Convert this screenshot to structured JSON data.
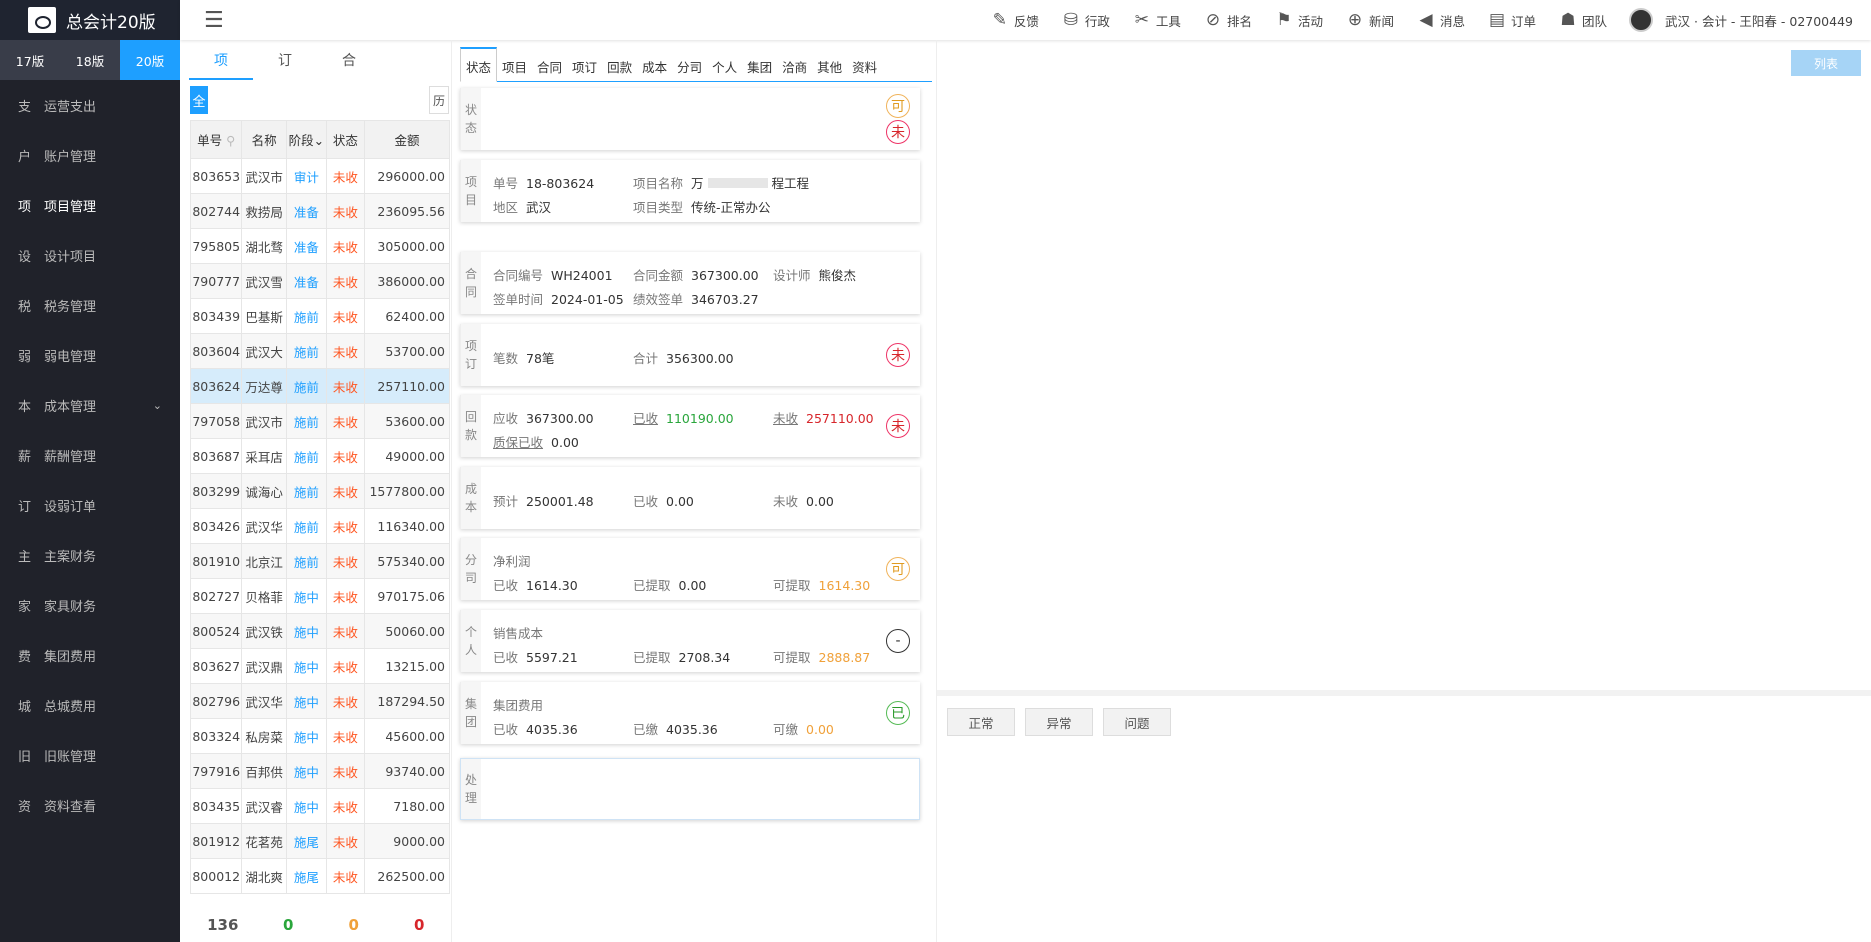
{
  "app": {
    "title": "总会计20版"
  },
  "topnav": [
    {
      "icon": "edit-icon",
      "glyph": "✎",
      "label": "反馈"
    },
    {
      "icon": "layers-icon",
      "glyph": "⛁",
      "label": "行政"
    },
    {
      "icon": "tools-icon",
      "glyph": "✂",
      "label": "工具"
    },
    {
      "icon": "compass-icon",
      "glyph": "⊘",
      "label": "排名"
    },
    {
      "icon": "flag-icon",
      "glyph": "⚑",
      "label": "活动"
    },
    {
      "icon": "globe-icon",
      "glyph": "⊕",
      "label": "新闻"
    },
    {
      "icon": "megaphone-icon",
      "glyph": "◀",
      "label": "消息"
    },
    {
      "icon": "clipboard-icon",
      "glyph": "▤",
      "label": "订单"
    },
    {
      "icon": "team-icon",
      "glyph": "☗",
      "label": "团队"
    }
  ],
  "user": {
    "text": "武汉 · 会计 - 王阳春 - 02700449"
  },
  "versions": [
    {
      "label": "17版"
    },
    {
      "label": "18版"
    },
    {
      "label": "20版"
    }
  ],
  "menu": [
    {
      "ch": "支",
      "label": "运营支出"
    },
    {
      "ch": "户",
      "label": "账户管理"
    },
    {
      "ch": "项",
      "label": "项目管理"
    },
    {
      "ch": "设",
      "label": "设计项目"
    },
    {
      "ch": "税",
      "label": "税务管理"
    },
    {
      "ch": "弱",
      "label": "弱电管理"
    },
    {
      "ch": "本",
      "label": "成本管理"
    },
    {
      "ch": "薪",
      "label": "薪酬管理"
    },
    {
      "ch": "订",
      "label": "设弱订单"
    },
    {
      "ch": "主",
      "label": "主案财务"
    },
    {
      "ch": "家",
      "label": "家具财务"
    },
    {
      "ch": "费",
      "label": "集团费用"
    },
    {
      "ch": "城",
      "label": "总城费用"
    },
    {
      "ch": "旧",
      "label": "旧账管理"
    },
    {
      "ch": "资",
      "label": "资料查看"
    }
  ],
  "lefttabs": [
    {
      "label": "项"
    },
    {
      "label": "订"
    },
    {
      "label": "合"
    }
  ],
  "filter": {
    "all": "全",
    "history": "历"
  },
  "table": {
    "headers": {
      "id": "单号",
      "name": "名称",
      "phase": "阶段",
      "status": "状态",
      "amount": "金额"
    },
    "rows": [
      {
        "id": "803653",
        "name": "武汉市",
        "phase": "审计",
        "status": "未收",
        "amount": "296000.00"
      },
      {
        "id": "802744",
        "name": "救捞局",
        "phase": "准备",
        "status": "未收",
        "amount": "236095.56"
      },
      {
        "id": "795805",
        "name": "湖北骛",
        "phase": "准备",
        "status": "未收",
        "amount": "305000.00"
      },
      {
        "id": "790777",
        "name": "武汉雪",
        "phase": "准备",
        "status": "未收",
        "amount": "386000.00"
      },
      {
        "id": "803439",
        "name": "巴基斯",
        "phase": "施前",
        "status": "未收",
        "amount": "62400.00"
      },
      {
        "id": "803604",
        "name": "武汉大",
        "phase": "施前",
        "status": "未收",
        "amount": "53700.00"
      },
      {
        "id": "803624",
        "name": "万达尊",
        "phase": "施前",
        "status": "未收",
        "amount": "257110.00"
      },
      {
        "id": "797058",
        "name": "武汉市",
        "phase": "施前",
        "status": "未收",
        "amount": "53600.00"
      },
      {
        "id": "803687",
        "name": "采耳店",
        "phase": "施前",
        "status": "未收",
        "amount": "49000.00"
      },
      {
        "id": "803299",
        "name": "诚海心",
        "phase": "施前",
        "status": "未收",
        "amount": "1577800.00"
      },
      {
        "id": "803426",
        "name": "武汉华",
        "phase": "施前",
        "status": "未收",
        "amount": "116340.00"
      },
      {
        "id": "801910",
        "name": "北京江",
        "phase": "施前",
        "status": "未收",
        "amount": "575340.00"
      },
      {
        "id": "802727",
        "name": "贝格菲",
        "phase": "施中",
        "status": "未收",
        "amount": "970175.06"
      },
      {
        "id": "800524",
        "name": "武汉铁",
        "phase": "施中",
        "status": "未收",
        "amount": "50060.00"
      },
      {
        "id": "803627",
        "name": "武汉鼎",
        "phase": "施中",
        "status": "未收",
        "amount": "13215.00"
      },
      {
        "id": "802796",
        "name": "武汉华",
        "phase": "施中",
        "status": "未收",
        "amount": "187294.50"
      },
      {
        "id": "803324",
        "name": "私房菜",
        "phase": "施中",
        "status": "未收",
        "amount": "45600.00"
      },
      {
        "id": "797916",
        "name": "百邦供",
        "phase": "施中",
        "status": "未收",
        "amount": "93740.00"
      },
      {
        "id": "803435",
        "name": "武汉睿",
        "phase": "施中",
        "status": "未收",
        "amount": "7180.00"
      },
      {
        "id": "801912",
        "name": "花茗苑",
        "phase": "施尾",
        "status": "未收",
        "amount": "9000.00"
      },
      {
        "id": "800012",
        "name": "湖北爽",
        "phase": "施尾",
        "status": "未收",
        "amount": "262500.00"
      }
    ],
    "footer": {
      "total": "136",
      "green": "0",
      "orange": "0",
      "red": "0"
    }
  },
  "ctabs": [
    "状态",
    "项目",
    "合同",
    "项订",
    "回款",
    "成本",
    "分司",
    "个人",
    "集团",
    "洽商",
    "其他",
    "资料"
  ],
  "cards": {
    "status": {
      "side": "状态",
      "b1": "可",
      "b2": "未"
    },
    "project": {
      "side": "项目",
      "k_id": "单号",
      "v_id": "18-803624",
      "k_name": "项目名称",
      "v_name": "万",
      "v_name2": "程工程",
      "k_area": "地区",
      "v_area": "武汉",
      "k_type": "项目类型",
      "v_type": "传统-正常办公"
    },
    "contract": {
      "side": "合同",
      "k_no": "合同编号",
      "v_no": "WH24001",
      "k_amt": "合同金额",
      "v_amt": "367300.00",
      "k_des": "设计师",
      "v_des": "熊俊杰",
      "k_date": "签单时间",
      "v_date": "2024-01-05",
      "k_perf": "绩效签单",
      "v_perf": "346703.27"
    },
    "order": {
      "side": "项订",
      "k_cnt": "笔数",
      "v_cnt": "78笔",
      "k_sum": "合计",
      "v_sum": "356300.00",
      "badge": "未"
    },
    "payment": {
      "side": "回款",
      "k_due": "应收",
      "v_due": "367300.00",
      "k_got": "已收",
      "v_got": "110190.00",
      "k_un": "未收",
      "v_un": "257110.00",
      "k_dep": "质保已收",
      "v_dep": "0.00",
      "badge": "未"
    },
    "cost": {
      "side": "成本",
      "k_est": "预计",
      "v_est": "250001.48",
      "k_got": "已收",
      "v_got": "0.00",
      "k_un": "未收",
      "v_un": "0.00"
    },
    "branch": {
      "side": "分司",
      "title": "净利润",
      "k_got": "已收",
      "v_got": "1614.30",
      "k_ext": "已提取",
      "v_ext": "0.00",
      "k_can": "可提取",
      "v_can": "1614.30",
      "badge": "可"
    },
    "person": {
      "side": "个人",
      "title": "销售成本",
      "k_got": "已收",
      "v_got": "5597.21",
      "k_ext": "已提取",
      "v_ext": "2708.34",
      "k_can": "可提取",
      "v_can": "2888.87",
      "badge": "-"
    },
    "group": {
      "side": "集团",
      "title": "集团费用",
      "k_got": "已收",
      "v_got": "4035.36",
      "k_paid": "已缴",
      "v_paid": "4035.36",
      "k_can": "可缴",
      "v_can": "0.00",
      "badge": "已"
    },
    "handle": {
      "side": "处理"
    }
  },
  "right": {
    "list_button": "列表",
    "buttons": [
      "正常",
      "异常",
      "问题"
    ]
  }
}
